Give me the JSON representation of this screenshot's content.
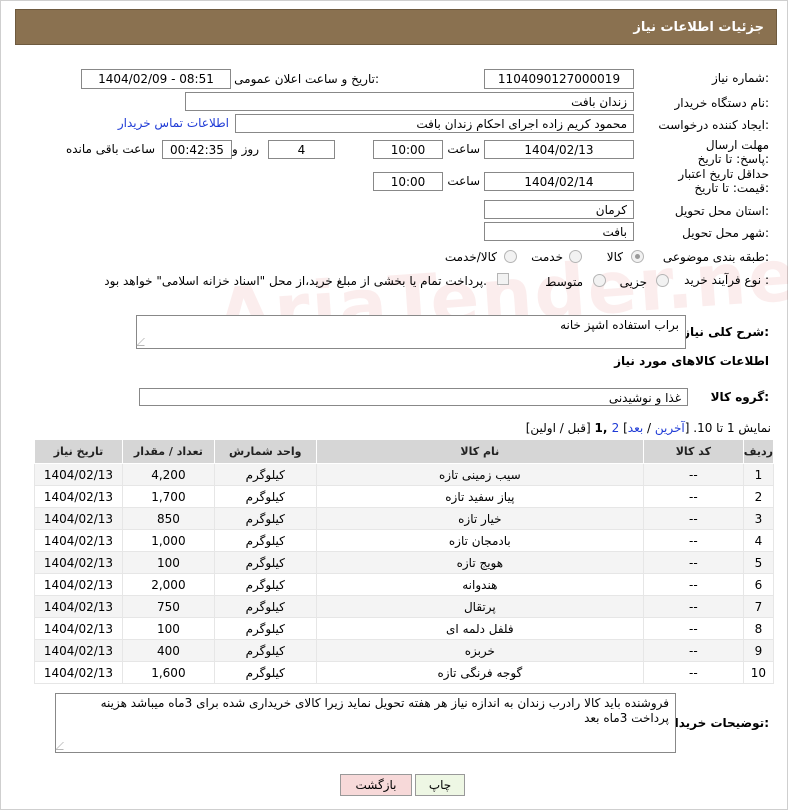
{
  "header": {
    "title": "جزئیات اطلاعات نیاز"
  },
  "form": {
    "need_number_label": "شماره نیاز:",
    "need_number": "1104090127000019",
    "announce_label": "تاریخ و ساعت اعلان عمومی:",
    "announce_value": "1404/02/09 - 08:51",
    "buyer_org_label": "نام دستگاه خریدار:",
    "buyer_org": "زندان بافت",
    "creator_label": "ایجاد کننده درخواست:",
    "creator": "محمود کریم زاده اجرای احکام زندان بافت",
    "contact_link": "اطلاعات تماس خریدار",
    "reply_deadline_label": "مهلت ارسال پاسخ: تا تاریخ:",
    "reply_date": "1404/02/13",
    "time_label": "ساعت",
    "reply_time": "10:00",
    "days_value": "4",
    "days_label": "روز و",
    "remaining_time": "00:42:35",
    "remaining_label": "ساعت باقی مانده",
    "price_validity_label": "حداقل تاریخ اعتبار قیمت: تا تاریخ:",
    "price_date": "1404/02/14",
    "price_time": "10:00",
    "province_label": "استان محل تحویل:",
    "province": "کرمان",
    "city_label": "شهر محل تحویل:",
    "city": "بافت",
    "category_label": "طبقه بندی موضوعی:",
    "category_options": [
      "کالا",
      "خدمت",
      "کالا/خدمت"
    ],
    "category_selected": "کالا",
    "process_label": "نوع فرآیند خرید :",
    "process_options": [
      "جزیی",
      "متوسط"
    ],
    "payment_note": "پرداخت تمام یا بخشی از مبلغ خرید،از محل \"اسناد خزانه اسلامی\" خواهد بود."
  },
  "description": {
    "label": "شرح کلی نیاز:",
    "text": "براب استفاده اشپز خانه"
  },
  "goods_section": {
    "title": "اطلاعات کالاهای مورد نیاز",
    "group_label": "گروه کالا:",
    "group_value": "غذا و نوشیدنی",
    "paging_prefix": "نمایش 1 تا 10. [",
    "paging_last": "آخرین",
    "paging_sep1": " / ",
    "paging_next": "بعد",
    "paging_sep2": "] ",
    "paging_page2": "2",
    "paging_current": " ,1",
    "paging_suffix": " [قبل / اولین]"
  },
  "table": {
    "headers": [
      "ردیف",
      "کد کالا",
      "نام کالا",
      "واحد شمارش",
      "تعداد / مقدار",
      "تاریخ نیاز"
    ],
    "rows": [
      [
        "1",
        "--",
        "سیب زمینی تازه",
        "کیلوگرم",
        "4,200",
        "1404/02/13"
      ],
      [
        "2",
        "--",
        "پیاز سفید تازه",
        "کیلوگرم",
        "1,700",
        "1404/02/13"
      ],
      [
        "3",
        "--",
        "خیار تازه",
        "کیلوگرم",
        "850",
        "1404/02/13"
      ],
      [
        "4",
        "--",
        "بادمجان تازه",
        "کیلوگرم",
        "1,000",
        "1404/02/13"
      ],
      [
        "5",
        "--",
        "هویج تازه",
        "کیلوگرم",
        "100",
        "1404/02/13"
      ],
      [
        "6",
        "--",
        "هندوانه",
        "کیلوگرم",
        "2,000",
        "1404/02/13"
      ],
      [
        "7",
        "--",
        "پرتقال",
        "کیلوگرم",
        "750",
        "1404/02/13"
      ],
      [
        "8",
        "--",
        "فلفل دلمه ای",
        "کیلوگرم",
        "100",
        "1404/02/13"
      ],
      [
        "9",
        "--",
        "خربزه",
        "کیلوگرم",
        "400",
        "1404/02/13"
      ],
      [
        "10",
        "--",
        "گوجه فرنگی تازه",
        "کیلوگرم",
        "1,600",
        "1404/02/13"
      ]
    ]
  },
  "buyer_notes": {
    "label": "توضیحات خریدار:",
    "text": "فروشنده باید کالا رادرب زندان به اندازه نیاز هر هفته  تحویل نماید زیرا کالای خریداری شده برای 3ماه میباشد هزینه پرداخت 3ماه بعد"
  },
  "buttons": {
    "print": "چاپ",
    "back": "بازگشت"
  },
  "watermark": "AriaTender.neT",
  "colors": {
    "header_bg": "#8a7150",
    "link": "#1f3bd6",
    "back_button_bg": "#f7d9d9",
    "print_button_bg": "#eef7e4"
  }
}
